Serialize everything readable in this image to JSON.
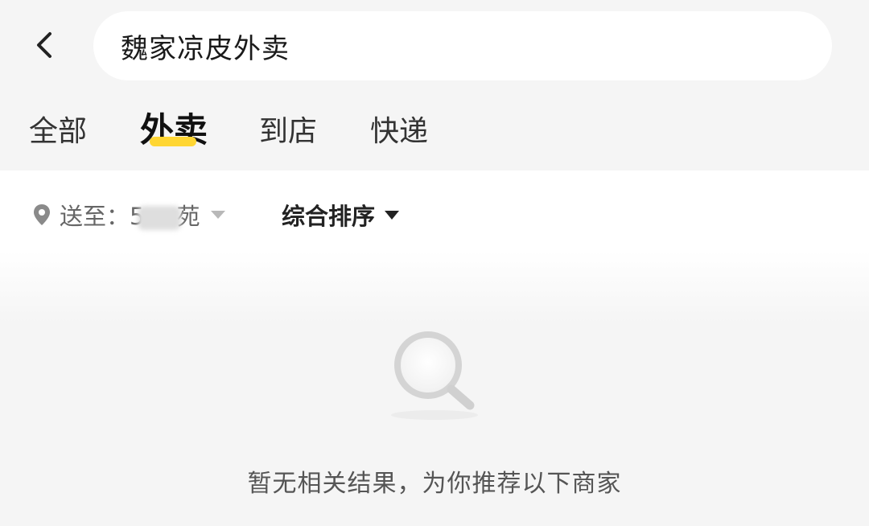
{
  "search": {
    "query": "魏家凉皮外卖"
  },
  "tabs": [
    {
      "label": "全部",
      "active": false
    },
    {
      "label": "外卖",
      "active": true
    },
    {
      "label": "到店",
      "active": false
    },
    {
      "label": "快递",
      "active": false
    }
  ],
  "filter": {
    "deliver_prefix": "送至：",
    "deliver_address_start": "5",
    "deliver_address_end": "苑",
    "sort_label": "综合排序"
  },
  "empty_state": {
    "message": "暂无相关结果，为你推荐以下商家"
  },
  "colors": {
    "accent": "#ffd633",
    "background": "#f5f5f5"
  },
  "icons": {
    "back": "chevron-left-icon",
    "location": "location-pin-icon",
    "empty": "magnifier-icon"
  }
}
